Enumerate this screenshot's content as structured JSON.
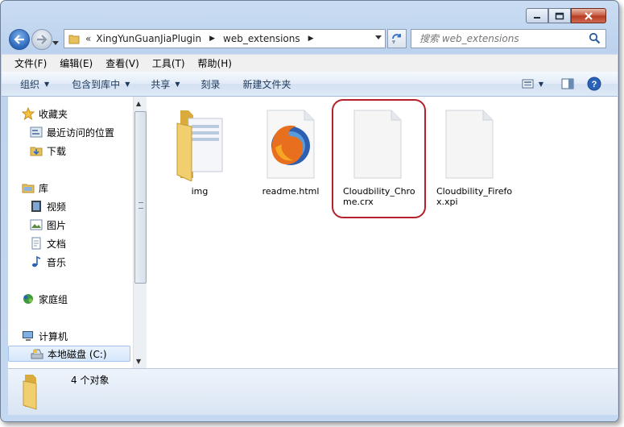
{
  "window": {
    "address_path": [
      "XingYunGuanJiaPlugin",
      "web_extensions"
    ],
    "address_prefix": "«",
    "search_placeholder": "搜索 web_extensions"
  },
  "menu": [
    "文件(F)",
    "编辑(E)",
    "查看(V)",
    "工具(T)",
    "帮助(H)"
  ],
  "commands": {
    "organize": "组织",
    "include_in_library": "包含到库中",
    "share": "共享",
    "burn": "刻录",
    "new_folder": "新建文件夹"
  },
  "nav": {
    "favorites": "收藏夹",
    "recent": "最近访问的位置",
    "downloads": "下载",
    "libraries": "库",
    "videos": "视频",
    "pictures": "图片",
    "documents": "文档",
    "music": "音乐",
    "homegroup": "家庭组",
    "computer": "计算机",
    "local_disk": "本地磁盘 (C:)"
  },
  "files": [
    {
      "name": "img",
      "type": "folder"
    },
    {
      "name": "readme.html",
      "type": "firefox-html"
    },
    {
      "name": "Cloudbility_Chrome.crx",
      "type": "blank-file"
    },
    {
      "name": "Cloudbility_Firefox.xpi",
      "type": "blank-file"
    }
  ],
  "status": {
    "count_text": "4 个对象"
  },
  "colors": {
    "highlight_ring": "#b5212b",
    "accent": "#1e395b"
  }
}
